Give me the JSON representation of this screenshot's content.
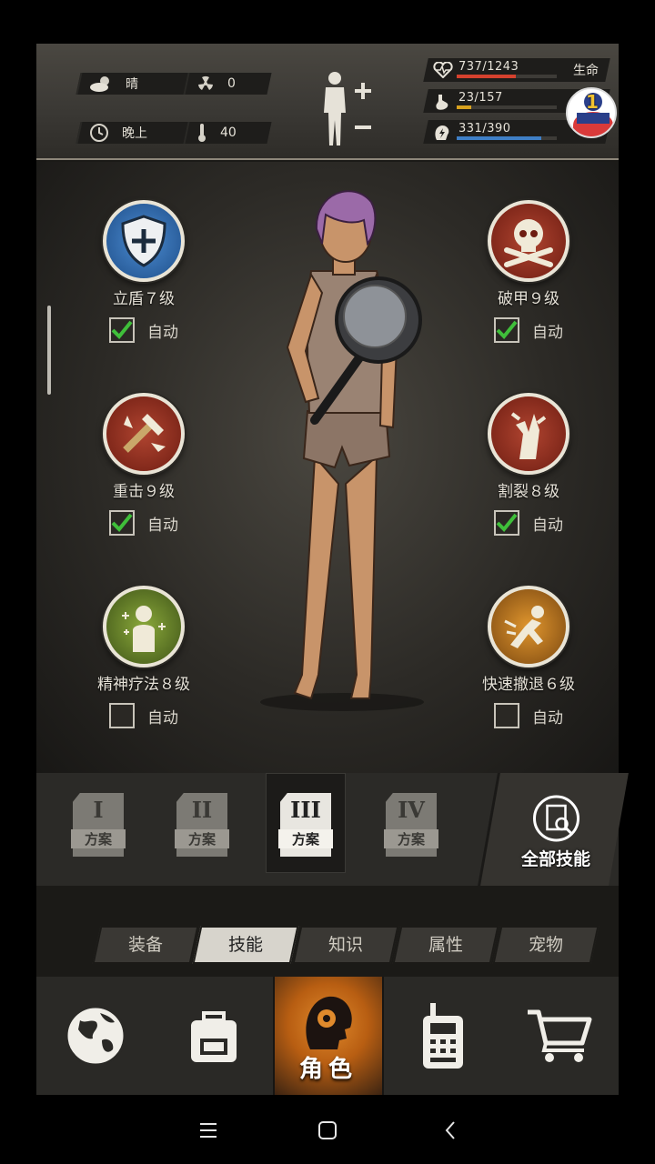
{
  "status": {
    "weather": "晴",
    "radiation": "0",
    "time_of_day": "晚上",
    "temperature": "40",
    "stats": [
      {
        "value": "737/1243",
        "label": "生命",
        "fraction": 0.593,
        "color": "#d5412e",
        "icon": "heart-pulse-icon"
      },
      {
        "value": "23/157",
        "label": "",
        "fraction": 0.146,
        "color": "#d8a21e",
        "icon": "stomach-icon"
      },
      {
        "value": "331/390",
        "label": "",
        "fraction": 0.849,
        "color": "#3f7fc6",
        "icon": "brain-bolt-icon"
      }
    ],
    "badge_number": "1"
  },
  "skills": [
    {
      "name": "立盾７级",
      "auto": "自动",
      "checked": true,
      "icon": "shield-icon",
      "color": "#2a6fb8"
    },
    {
      "name": "破甲９级",
      "auto": "自动",
      "checked": true,
      "icon": "skull-crossbones-icon",
      "color": "#8a2a1c"
    },
    {
      "name": "重击９级",
      "auto": "自动",
      "checked": true,
      "icon": "heavy-strike-icon",
      "color": "#8a2a1c"
    },
    {
      "name": "割裂８级",
      "auto": "自动",
      "checked": true,
      "icon": "rend-icon",
      "color": "#8a2a1c"
    },
    {
      "name": "精神疗法８级",
      "auto": "自动",
      "checked": false,
      "icon": "mental-therapy-icon",
      "color": "#6b8a2a"
    },
    {
      "name": "快速撤退６级",
      "auto": "自动",
      "checked": false,
      "icon": "quick-retreat-icon",
      "color": "#b8721c"
    }
  ],
  "plans": [
    {
      "num": "I",
      "label": "方案",
      "active": false
    },
    {
      "num": "II",
      "label": "方案",
      "active": false
    },
    {
      "num": "III",
      "label": "方案",
      "active": true
    },
    {
      "num": "IV",
      "label": "方案",
      "active": false
    }
  ],
  "all_skills_label": "全部技能",
  "categories": [
    {
      "label": "装备",
      "active": false
    },
    {
      "label": "技能",
      "active": true
    },
    {
      "label": "知识",
      "active": false
    },
    {
      "label": "属性",
      "active": false
    },
    {
      "label": "宠物",
      "active": false
    }
  ],
  "nav": {
    "character_label": "角色"
  }
}
